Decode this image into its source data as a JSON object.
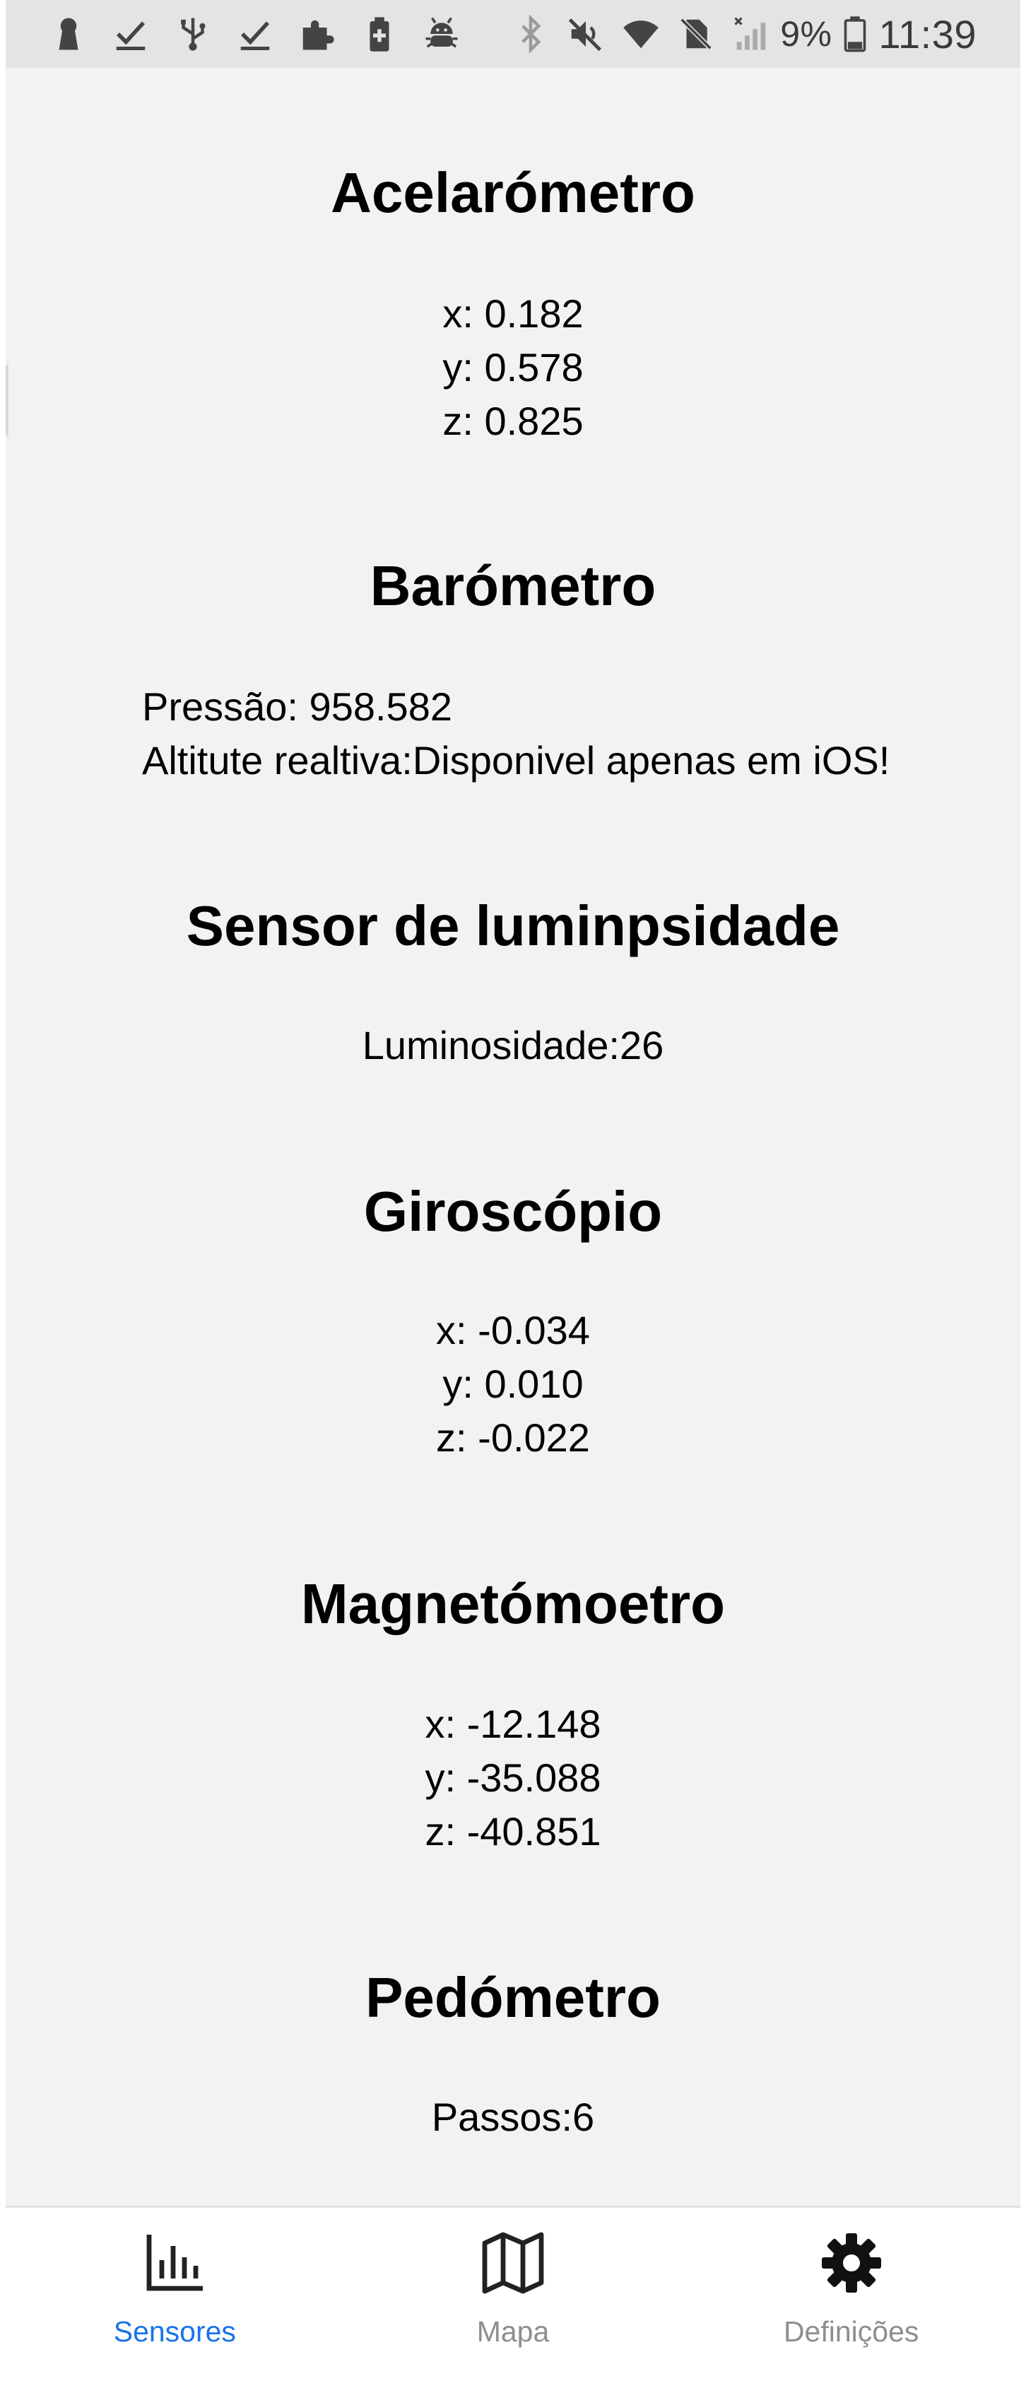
{
  "status_bar": {
    "left_icons": [
      "keyhole-icon",
      "check-icon",
      "usb-icon",
      "check-icon",
      "puzzle-icon",
      "battery-saver-icon",
      "android-debug-icon"
    ],
    "right_icons": [
      "bluetooth-icon",
      "mute-icon",
      "wifi-icon",
      "no-sim-icon",
      "signal-icon"
    ],
    "battery_percent": "9%",
    "time": "11:39"
  },
  "sensors": {
    "accelerometer": {
      "title": "Acelarómetro",
      "x": "x: 0.182",
      "y": "y: 0.578",
      "z": "z: 0.825"
    },
    "barometer": {
      "title": "Barómetro",
      "pressure": "Pressão: 958.582",
      "altitude": "Altitute realtiva:Disponivel apenas em iOS!"
    },
    "light": {
      "title": "Sensor de luminpsidade",
      "luminosity": "Luminosidade:26"
    },
    "gyroscope": {
      "title": "Giroscópio",
      "x": "x: -0.034",
      "y": "y: 0.010",
      "z": "z: -0.022"
    },
    "magnetometer": {
      "title": "Magnetómoetro",
      "x": "x: -12.148",
      "y": "y: -35.088",
      "z": "z: -40.851"
    },
    "pedometer": {
      "title": "Pedómetro",
      "steps": "Passos:6"
    }
  },
  "tab_bar": {
    "tabs": [
      {
        "label": "Sensores",
        "icon": "bar-chart-icon",
        "active": true
      },
      {
        "label": "Mapa",
        "icon": "map-icon",
        "active": false
      },
      {
        "label": "Definições",
        "icon": "gear-icon",
        "active": false
      }
    ],
    "colors": {
      "active": "#1a73e8",
      "inactive": "#8e8e8e"
    }
  }
}
